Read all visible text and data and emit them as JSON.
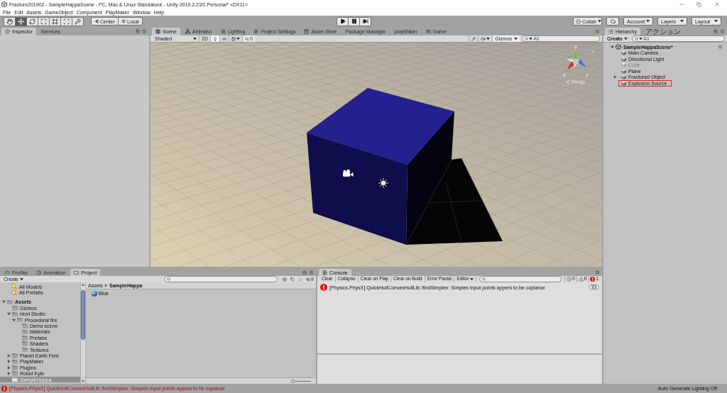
{
  "window": {
    "title": "Fracture201902 - SampleHappaScene - PC, Mac & Linux Standalone - Unity 2019.2.21f1 Personal* <DX11>"
  },
  "menu": [
    "File",
    "Edit",
    "Assets",
    "GameObject",
    "Component",
    "PlayMaker",
    "Window",
    "Help"
  ],
  "toolbar": {
    "tools": [
      {
        "kind": "hand",
        "selected": false
      },
      {
        "kind": "move",
        "selected": true
      },
      {
        "kind": "rotate",
        "selected": false
      },
      {
        "kind": "scale",
        "selected": false
      },
      {
        "kind": "rect",
        "selected": false
      },
      {
        "kind": "transform",
        "selected": false
      },
      {
        "kind": "custom",
        "selected": false
      }
    ],
    "pivot": [
      {
        "kind": "pivot",
        "label": "Center"
      },
      {
        "kind": "rotation",
        "label": "Local"
      }
    ],
    "playback": [
      {
        "kind": "play",
        "on": false
      },
      {
        "kind": "pause",
        "on": false
      },
      {
        "kind": "step",
        "on": false
      }
    ],
    "right": [
      {
        "kind": "collab",
        "label": "Collab"
      },
      {
        "kind": "cloud"
      },
      {
        "kind": "dropdown",
        "label": "Account"
      },
      {
        "kind": "dropdown",
        "label": "Layers"
      },
      {
        "kind": "dropdown",
        "label": "Layout"
      }
    ]
  },
  "inspector": {
    "tabs": [
      {
        "label": "Inspector",
        "selected": true
      },
      {
        "label": "Services",
        "selected": false
      }
    ]
  },
  "scene": {
    "tabs": [
      {
        "label": "Scene",
        "selected": true
      },
      {
        "label": "Animator",
        "selected": false
      },
      {
        "label": "Lighting",
        "selected": false
      },
      {
        "label": "Project Settings",
        "selected": false
      },
      {
        "label": "Asset Store",
        "selected": false
      },
      {
        "label": "Package Manager",
        "selected": false
      },
      {
        "label": "playMaker",
        "selected": false
      },
      {
        "label": "Game",
        "selected": false
      }
    ],
    "toolbar": {
      "shading": "Shaded",
      "mode_2d": {
        "label": "2D",
        "on": false
      },
      "toggles": [
        {
          "kind": "lighting",
          "on": true
        },
        {
          "kind": "audio",
          "on": false
        },
        {
          "kind": "effects",
          "on": false
        }
      ],
      "hidden_count": "0",
      "gizmos": "Gizmos",
      "search_placeholder": "All"
    },
    "gizmo": {
      "axes": [
        "y",
        "x",
        "z"
      ],
      "projection": "Persp"
    }
  },
  "hierarchy": {
    "tabs": [
      {
        "label": "Hierarchy",
        "selected": true
      },
      {
        "label": "アクション",
        "selected": false
      }
    ],
    "create": "Create",
    "search_placeholder": "All",
    "scene": {
      "name": "SampleHappaScene*",
      "expanded": true
    },
    "objects": [
      {
        "name": "Main Camera",
        "active": true,
        "outlined": false
      },
      {
        "name": "Directional Light",
        "active": true,
        "outlined": false
      },
      {
        "name": "Cube",
        "active": false,
        "outlined": false
      },
      {
        "name": "Plane",
        "active": true,
        "outlined": false
      },
      {
        "name": "Fractured Object",
        "active": true,
        "outlined": false,
        "expanded": false
      },
      {
        "name": "Explosion Source",
        "active": true,
        "outlined": true
      }
    ]
  },
  "project": {
    "tabs": [
      {
        "label": "Profiler",
        "selected": false
      },
      {
        "label": "Animation",
        "selected": false
      },
      {
        "label": "Project",
        "selected": true
      }
    ],
    "create": "Create",
    "hidden_count": "9",
    "favorites": [
      {
        "name": "All Models",
        "selected": false
      },
      {
        "name": "All Prefabs",
        "selected": false
      }
    ],
    "tree": {
      "name": "Assets",
      "expanded": true,
      "selected": false,
      "children": [
        {
          "name": "Gizmos",
          "selected": false
        },
        {
          "name": "Hovl Studio",
          "expanded": true,
          "selected": false,
          "children": [
            {
              "name": "Procedural fire",
              "expanded": true,
              "selected": false,
              "children": [
                {
                  "name": "Demo scene",
                  "selected": false
                },
                {
                  "name": "Materials",
                  "selected": false
                },
                {
                  "name": "Prefabs",
                  "selected": false
                },
                {
                  "name": "Shaders",
                  "selected": false
                },
                {
                  "name": "Textures",
                  "selected": false
                }
              ]
            }
          ]
        },
        {
          "name": "Planet Earth Free",
          "expanded": false,
          "selected": false
        },
        {
          "name": "PlayMaker",
          "expanded": false,
          "selected": false
        },
        {
          "name": "Plugins",
          "expanded": false,
          "selected": false
        },
        {
          "name": "Robot Kyle",
          "expanded": false,
          "selected": false
        },
        {
          "name": "SampleHappa",
          "selected": true
        }
      ]
    },
    "breadcrumb": [
      "Assets",
      "SampleHappa"
    ],
    "items": [
      {
        "name": "Blue"
      }
    ],
    "size_slider": {
      "level": 0
    }
  },
  "console": {
    "tabs": [
      {
        "label": "Console",
        "selected": true
      }
    ],
    "buttons": [
      {
        "label": "Clear"
      },
      {
        "label": "Collapse"
      },
      {
        "label": "Clear on Play"
      },
      {
        "label": "Clear on Build"
      },
      {
        "label": "Error Pause"
      },
      {
        "label": "Editor",
        "dropdown": true
      }
    ],
    "counts": [
      {
        "kind": "info",
        "count": "0"
      },
      {
        "kind": "warning",
        "count": "0"
      },
      {
        "kind": "error",
        "count": "1"
      }
    ],
    "entries": [
      {
        "kind": "error",
        "message": "[Physics.PhysX] QuickHullConvexHullLib::findSimplex: Simplex input points appers to be coplanar.",
        "count": "33"
      }
    ]
  },
  "status_bar": {
    "kind": "error",
    "message": "[Physics.PhysX] QuickHullConvexHullLib::findSimplex: Simplex input points appers to be coplanar.",
    "lighting": "Auto Generate Lighting Off"
  }
}
